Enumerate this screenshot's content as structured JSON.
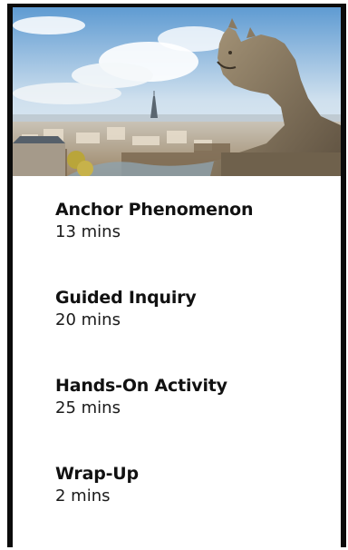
{
  "hero_image": {
    "subject": "Paris skyline with gargoyle statue",
    "colors": {
      "sky_top": "#6aa3d6",
      "sky_bottom": "#dfe9f2",
      "city": "#b8a48a",
      "stone": "#8a7a62"
    }
  },
  "agenda": {
    "items": [
      {
        "title": "Anchor Phenomenon",
        "duration": "13 mins"
      },
      {
        "title": "Guided Inquiry",
        "duration": "20 mins"
      },
      {
        "title": "Hands-On Activity",
        "duration": "25 mins"
      },
      {
        "title": "Wrap-Up",
        "duration": "2 mins"
      }
    ]
  }
}
